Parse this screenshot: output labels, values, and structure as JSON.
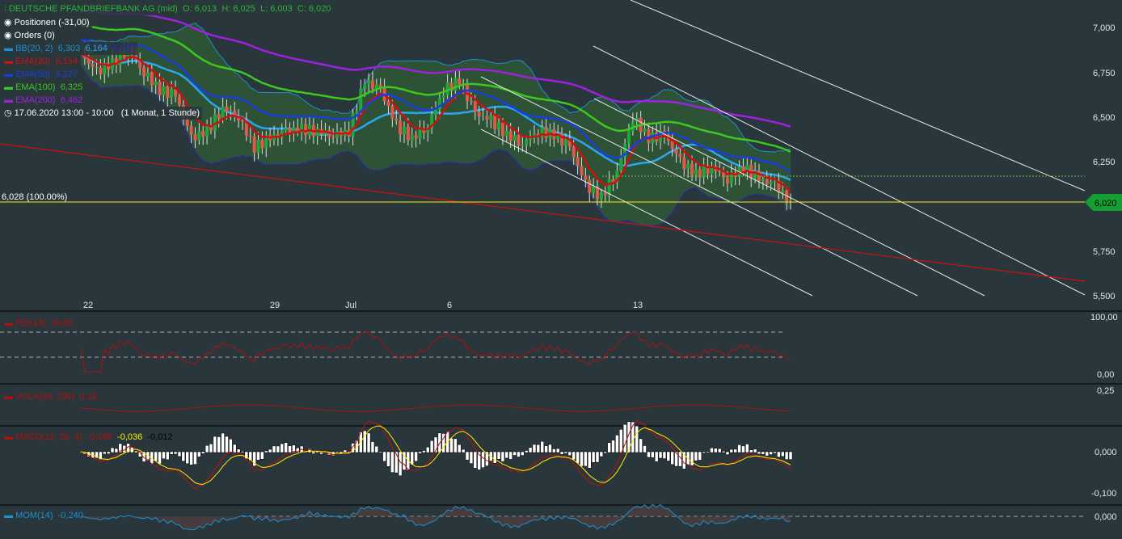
{
  "header": {
    "title": "DEUTSCHE PFANDBRIEFBANK AG (mid)",
    "open": "O: 6,013",
    "high": "H: 6,025",
    "low": "L: 6,003",
    "close": "C: 6,020"
  },
  "legend": {
    "positions": "Positionen (-31,00)",
    "orders": "Orders (0)",
    "bb": {
      "label": "BB(20, 2)",
      "upper": "6,303",
      "mid": "6,164",
      "lower": "6,025"
    },
    "ema20": {
      "label": "EMA(20)",
      "value": "6,154"
    },
    "ema50": {
      "label": "EMA(50)",
      "value": "6,227"
    },
    "ema100": {
      "label": "EMA(100)",
      "value": "6,325"
    },
    "ema200": {
      "label": "EMA(200)",
      "value": "6,462"
    },
    "period": "17.06.2020 13:00 - 10:00",
    "range": "(1 Monat, 1 Stunde)",
    "rsi": {
      "label": "RSI(14)",
      "value": "36,85"
    },
    "vola": {
      "label": "VOLA(30, 250)",
      "value": "0,16"
    },
    "macd": {
      "label": "MACD(12, 26, 9)",
      "macd": "-0,048",
      "signal": "-0,036",
      "hist": "-0,012"
    },
    "mom": {
      "label": "MOM(14)",
      "value": "-0,240"
    }
  },
  "ref_line": "6,028 (100.00%)",
  "last_price": "6,020",
  "colors": {
    "bg": "#29363b",
    "up": "#1fa83a",
    "down": "#e05a4a",
    "ema20": "#cc1111",
    "ema50": "#1a3fe0",
    "ema100": "#3cc81e",
    "ema200": "#a020e0",
    "bb": "#1e8fd0",
    "yellow": "#ffee00"
  },
  "chart_data": {
    "type": "candlestick",
    "title": "DEUTSCHE PFANDBRIEFBANK AG (mid)",
    "x_ticks": [
      "22",
      "29",
      "Jul",
      "6",
      "13"
    ],
    "y_ticks": [
      "7,000",
      "6,750",
      "6,500",
      "6,250",
      "5,750",
      "5,500"
    ],
    "ylim": [
      5.5,
      7.0
    ],
    "closes": [
      6.85,
      6.75,
      6.8,
      6.88,
      6.75,
      6.65,
      6.62,
      6.38,
      6.42,
      6.55,
      6.5,
      6.33,
      6.38,
      6.42,
      6.43,
      6.42,
      6.4,
      6.42,
      6.7,
      6.65,
      6.45,
      6.38,
      6.45,
      6.65,
      6.7,
      6.52,
      6.48,
      6.4,
      6.35,
      6.42,
      6.4,
      6.33,
      6.12,
      6.05,
      6.2,
      6.5,
      6.38,
      6.4,
      6.25,
      6.18,
      6.22,
      6.15,
      6.22,
      6.15,
      6.12,
      6.02
    ],
    "panels": {
      "rsi": {
        "ticks": [
          "100,00",
          "0,00"
        ],
        "levels": [
          70,
          30
        ]
      },
      "vola": {
        "ticks": [
          "0,25"
        ]
      },
      "macd": {
        "ticks": [
          "0,000",
          "-0,100"
        ]
      },
      "mom": {
        "ticks": [
          "0,000"
        ]
      }
    }
  }
}
